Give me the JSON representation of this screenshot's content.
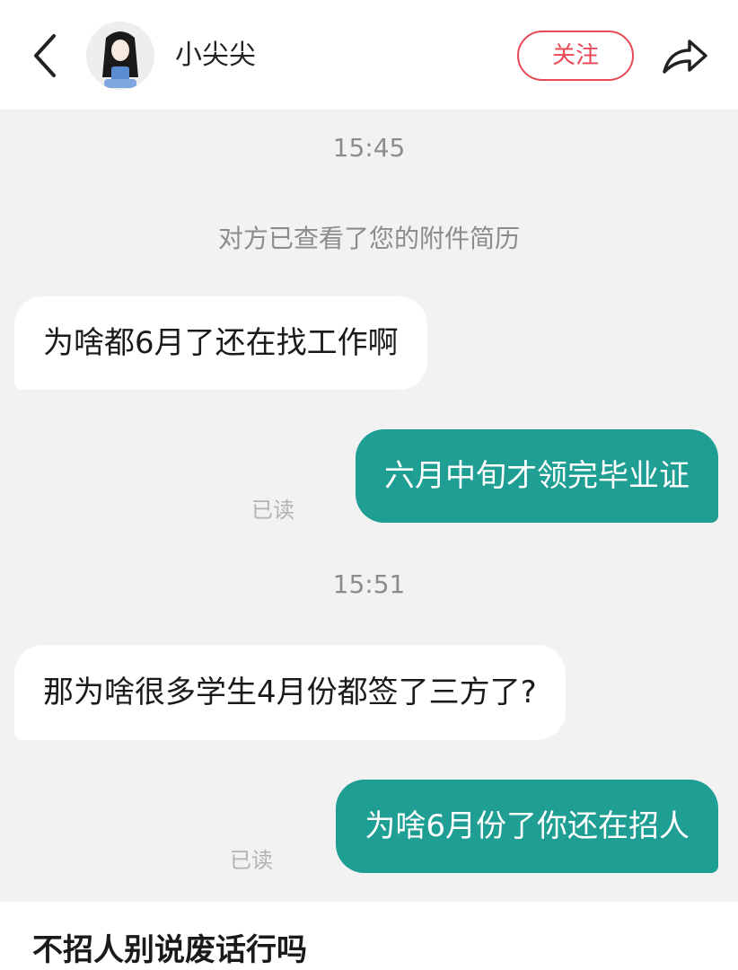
{
  "header": {
    "contact_name": "小尖尖",
    "follow_label": "关注",
    "back_icon": "chevron-left-icon",
    "share_icon": "share-icon"
  },
  "chat": {
    "time_1": "15:45",
    "system_notice": "对方已查看了您的附件简历",
    "msg_1": "为啥都6月了还在找工作啊",
    "msg_2": "六月中旬才领完毕业证",
    "msg_2_status": "已读",
    "time_2": "15:51",
    "msg_3": "那为啥很多学生4月份都签了三方了?",
    "msg_4": "为啥6月份了你还在招人",
    "msg_4_status": "已读"
  },
  "caption": "不招人别说废话行吗",
  "colors": {
    "accent_red": "#e84955",
    "outgoing_bubble": "#1f9e94",
    "chat_background": "#f2f2f2"
  }
}
